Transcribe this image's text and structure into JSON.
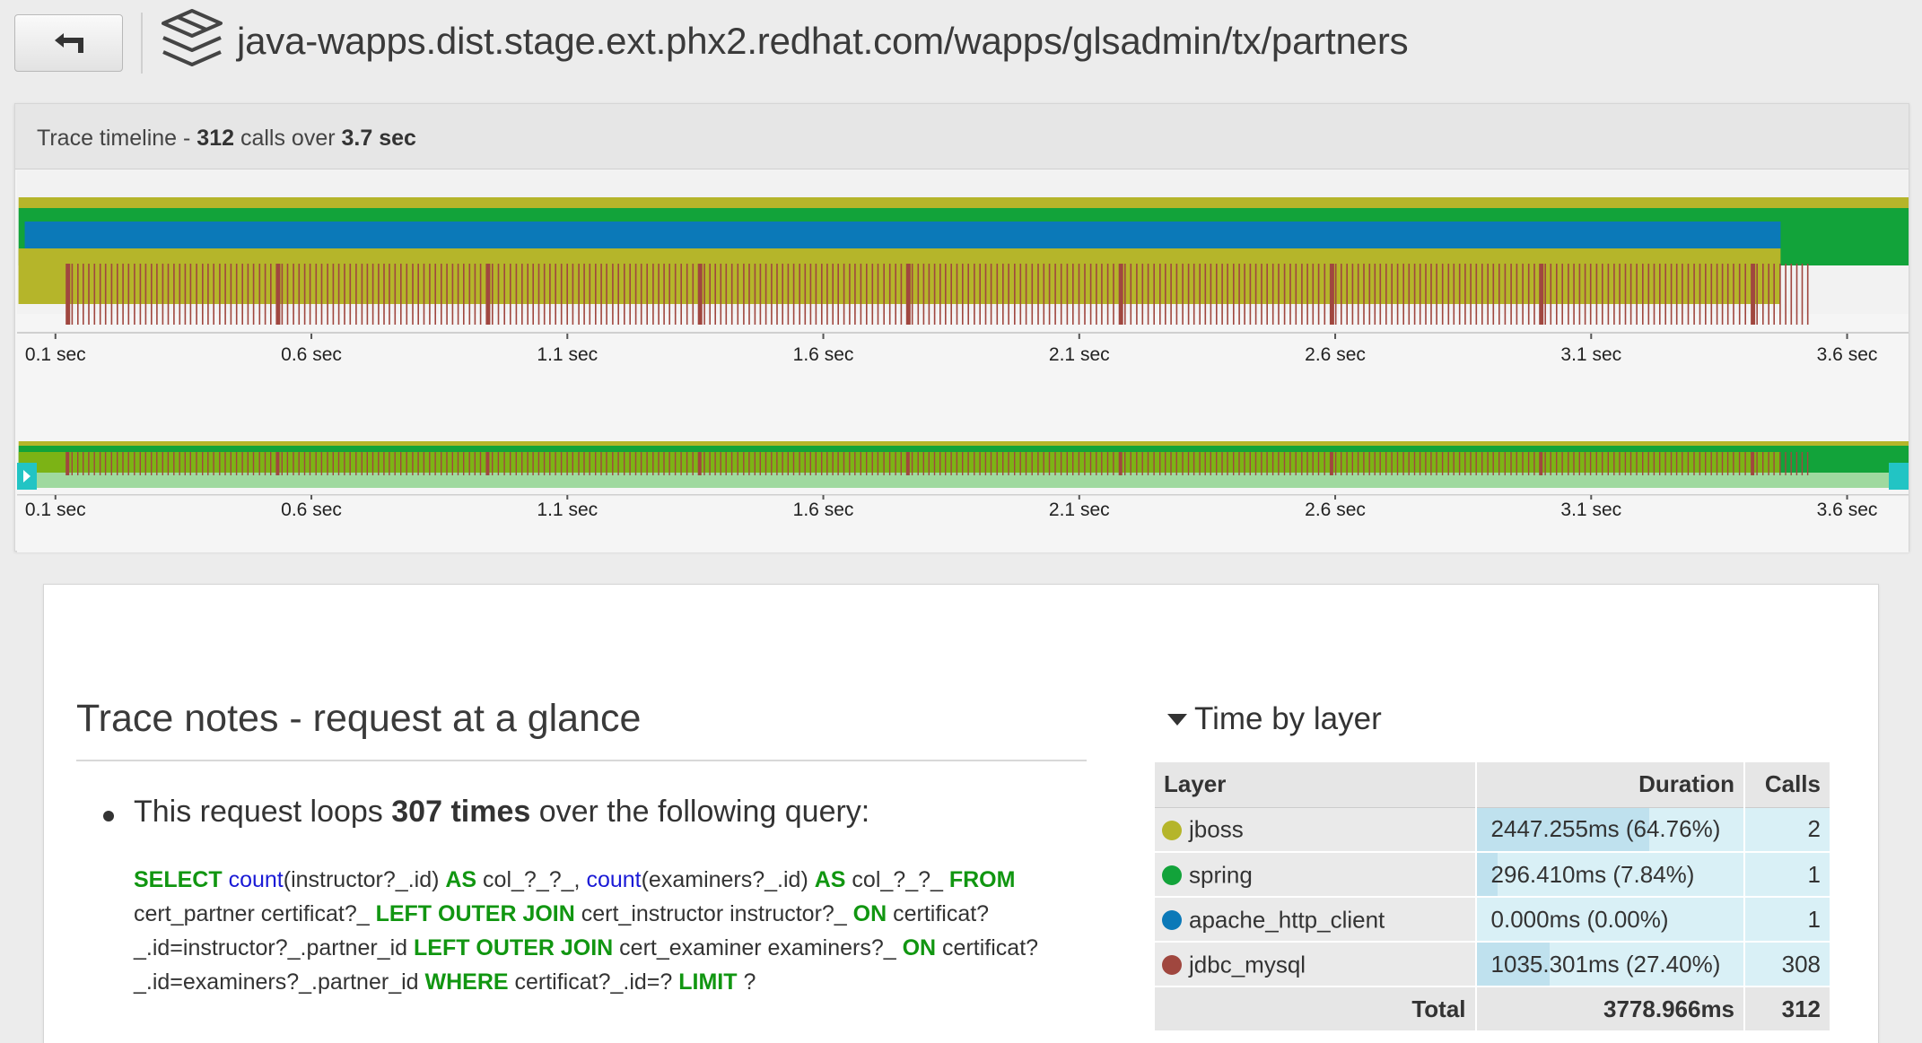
{
  "topbar": {
    "back_icon": "back-arrow-icon",
    "logo_icon": "layers-logo-icon",
    "url": "java-wapps.dist.stage.ext.phx2.redhat.com/wapps/glsadmin/tx/partners"
  },
  "timeline": {
    "title_prefix": "Trace timeline - ",
    "calls": "312",
    "calls_word": " calls over ",
    "duration": "3.7 sec",
    "tick_labels": [
      "0.1 sec",
      "0.6 sec",
      "1.1 sec",
      "1.6 sec",
      "2.1 sec",
      "2.6 sec",
      "3.1 sec",
      "3.6 sec"
    ],
    "colors": {
      "jboss": "#b5b52a",
      "spring": "#12a33a",
      "apache_http_client": "#0b79b8",
      "jdbc_mysql": "#a0473f",
      "mini_highlight": "#22c4c4"
    }
  },
  "notes": {
    "title": "Trace notes - request at a glance",
    "loop_prefix": "This request loops ",
    "loop_count": "307 times",
    "loop_suffix": " over the following query:",
    "sql": [
      {
        "t": "SELECT",
        "k": "kw"
      },
      {
        "t": " ",
        "k": ""
      },
      {
        "t": "count",
        "k": "fn"
      },
      {
        "t": "(instructor?_.id) ",
        "k": ""
      },
      {
        "t": "AS",
        "k": "kw"
      },
      {
        "t": " col_?_?_, ",
        "k": ""
      },
      {
        "t": "count",
        "k": "fn"
      },
      {
        "t": "(examiners?_.id) ",
        "k": ""
      },
      {
        "t": "AS",
        "k": "kw"
      },
      {
        "t": " col_?_?_ ",
        "k": ""
      },
      {
        "t": "FROM",
        "k": "kw"
      },
      {
        "t": " cert_partner certificat?_ ",
        "k": ""
      },
      {
        "t": "LEFT OUTER JOIN",
        "k": "kw"
      },
      {
        "t": " cert_instructor instructor?_ ",
        "k": ""
      },
      {
        "t": "ON",
        "k": "kw"
      },
      {
        "t": " certificat?_.id=instructor?_.partner_id ",
        "k": ""
      },
      {
        "t": "LEFT OUTER JOIN",
        "k": "kw"
      },
      {
        "t": " cert_examiner examiners?_ ",
        "k": ""
      },
      {
        "t": "ON",
        "k": "kw"
      },
      {
        "t": " certificat?_.id=examiners?_.partner_id ",
        "k": ""
      },
      {
        "t": "WHERE",
        "k": "kw"
      },
      {
        "t": " certificat?_.id=? ",
        "k": ""
      },
      {
        "t": "LIMIT",
        "k": "kw"
      },
      {
        "t": " ?",
        "k": ""
      }
    ]
  },
  "time_by_layer": {
    "title": "Time by layer",
    "headers": {
      "layer": "Layer",
      "duration": "Duration",
      "calls": "Calls"
    },
    "rows": [
      {
        "name": "jboss",
        "color": "#b5b52a",
        "duration": "2447.255ms (64.76%)",
        "pct": 0.6476,
        "calls": "2"
      },
      {
        "name": "spring",
        "color": "#12a33a",
        "duration": "296.410ms (7.84%)",
        "pct": 0.0784,
        "calls": "1"
      },
      {
        "name": "apache_http_client",
        "color": "#0b79b8",
        "duration": "0.000ms (0.00%)",
        "pct": 0.0,
        "calls": "1"
      },
      {
        "name": "jdbc_mysql",
        "color": "#a0473f",
        "duration": "1035.301ms (27.40%)",
        "pct": 0.274,
        "calls": "308"
      }
    ],
    "total": {
      "label": "Total",
      "duration": "3778.966ms",
      "calls": "312"
    }
  }
}
